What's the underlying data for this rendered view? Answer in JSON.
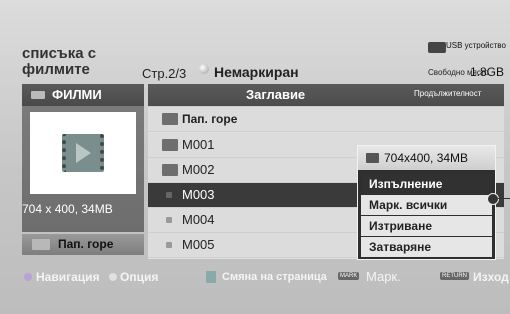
{
  "header": {
    "title_line1": "списъка с",
    "title_line2": "филмите",
    "page": "Стр.2/3",
    "filter": "Немаркиран",
    "usb_label": "USB устройство",
    "free_space_label": "Свободно място",
    "free_space_value": "1.8GB"
  },
  "left_panel": {
    "title": "ФИЛМИ",
    "resolution": "704 x 400, 34MB",
    "up_button": "Пап. горе"
  },
  "list": {
    "columns": {
      "title": "Заглавие",
      "duration": "Продължителност"
    },
    "rows": [
      {
        "label": "Пап. горе",
        "type": "up-folder"
      },
      {
        "label": "M001",
        "type": "file"
      },
      {
        "label": "M002",
        "type": "file"
      },
      {
        "label": "M003",
        "type": "file",
        "selected": true
      },
      {
        "label": "M004",
        "type": "file"
      },
      {
        "label": "M005",
        "type": "file"
      }
    ]
  },
  "popup": {
    "info": "704x400, 34MB",
    "items": [
      "Изпълнение",
      "Марк. всички",
      "Изтриване",
      "Затваряне"
    ],
    "active_index": 0
  },
  "footer": {
    "navigation": "Навигация",
    "option": "Опция",
    "change_page": "Смяна на страница",
    "mark_badge": "MARK",
    "mark": "Марк.",
    "return_badge": "RETURN",
    "exit": "Изход"
  }
}
